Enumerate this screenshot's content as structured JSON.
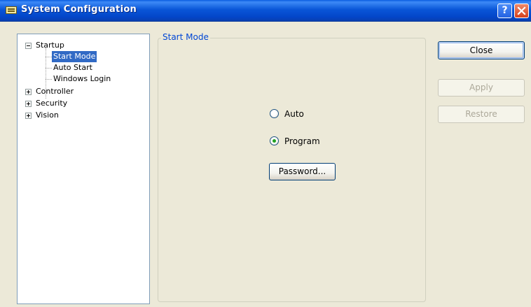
{
  "window": {
    "title": "System Configuration",
    "help_glyph": "?"
  },
  "tree": {
    "items": [
      {
        "label": "Startup",
        "expanded": true
      },
      {
        "label": "Start Mode",
        "selected": true
      },
      {
        "label": "Auto Start"
      },
      {
        "label": "Windows Login"
      },
      {
        "label": "Controller",
        "expanded": false
      },
      {
        "label": "Security",
        "expanded": false
      },
      {
        "label": "Vision",
        "expanded": false
      }
    ]
  },
  "group": {
    "title": "Start Mode"
  },
  "radios": {
    "auto": {
      "label": "Auto",
      "checked": false
    },
    "program": {
      "label": "Program",
      "checked": true
    }
  },
  "buttons": {
    "password": "Password...",
    "close": "Close",
    "apply": "Apply",
    "restore": "Restore"
  },
  "colors": {
    "title_bar": "#0a56d8",
    "tree_selection": "#316ac5",
    "group_title": "#0046d5",
    "dialog_background": "#ece9d8",
    "radio_dot": "#21a121"
  },
  "icons": [
    "app-icon",
    "help-icon",
    "close-icon",
    "expand-minus-icon",
    "expand-plus-icon"
  ]
}
